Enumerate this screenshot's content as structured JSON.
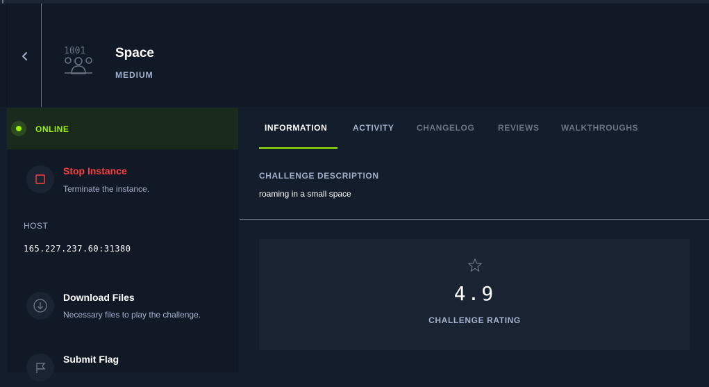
{
  "challenge": {
    "title": "Space",
    "difficulty": "MEDIUM",
    "icon": "binary-user-icon"
  },
  "status": {
    "label": "ONLINE",
    "color": "#9fef00"
  },
  "actions": {
    "stop": {
      "title": "Stop Instance",
      "subtitle": "Terminate the instance.",
      "color": "#ff3e3e",
      "icon": "stop-icon"
    },
    "download": {
      "title": "Download Files",
      "subtitle": "Necessary files to play the challenge.",
      "icon": "download-icon"
    },
    "submit": {
      "title": "Submit Flag",
      "icon": "flag-icon"
    }
  },
  "host": {
    "label": "HOST",
    "value": "165.227.237.60:31380"
  },
  "tabs": [
    {
      "label": "INFORMATION",
      "active": true
    },
    {
      "label": "ACTIVITY",
      "active": false
    },
    {
      "label": "CHANGELOG",
      "active": false
    },
    {
      "label": "REVIEWS",
      "active": false
    },
    {
      "label": "WALKTHROUGHS",
      "active": false
    }
  ],
  "description": {
    "label": "CHALLENGE DESCRIPTION",
    "text": "roaming in a small space"
  },
  "rating": {
    "value": "4.9",
    "label": "CHALLENGE RATING",
    "icon": "star-icon"
  },
  "colors": {
    "accent": "#9fef00",
    "danger": "#ff3e3e",
    "muted": "#a4b1cd"
  }
}
